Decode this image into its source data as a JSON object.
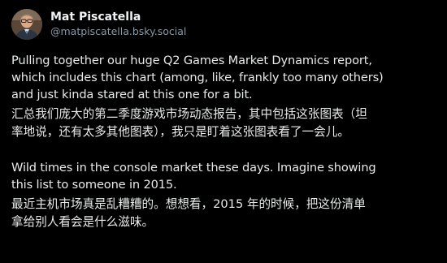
{
  "post": {
    "author": {
      "display_name": "Mat Piscatella",
      "handle": "@matpiscatella.bsky.social",
      "avatar_icon": "avatar-photo-icon"
    },
    "paragraphs": [
      {
        "lines": [
          "Pulling together our huge Q2 Games Market Dynamics report,",
          "which includes this chart (among, like, frankly too many others)",
          "and just kinda stared at this one for a bit."
        ]
      },
      {
        "lines": [
          "汇总我们庞大的第二季度游戏市场动态报告，其中包括这张图表（坦",
          "率地说，还有太多其他图表），我只是盯着这张图表看了一会儿。"
        ]
      },
      {
        "lines": [
          "Wild times in the console market these days. Imagine showing",
          "this list to someone in 2015."
        ]
      },
      {
        "lines": [
          "最近主机市场真是乱糟糟的。想想看，2015 年的时候，把这份清单",
          "拿给别人看会是什么滋味。"
        ]
      }
    ]
  },
  "colors": {
    "background": "#000000",
    "text": "#e7e9ea",
    "handle": "#8b98a5"
  }
}
